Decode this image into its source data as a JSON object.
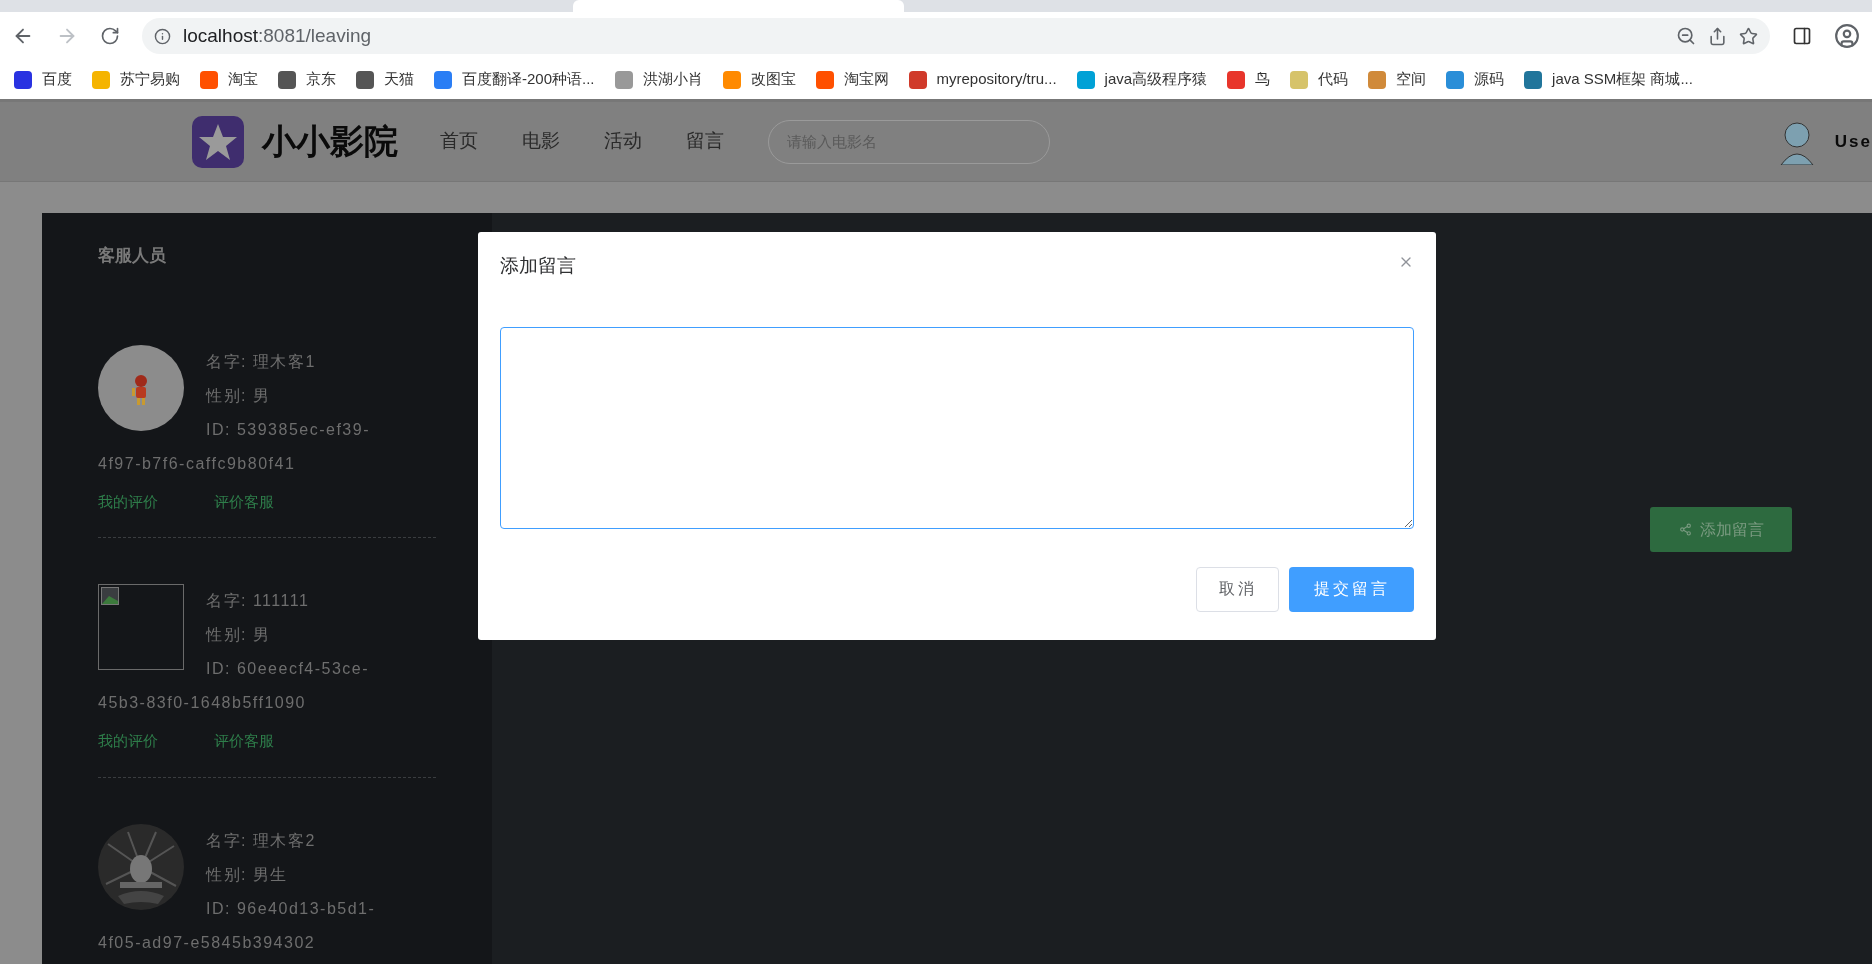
{
  "address": {
    "host": "localhost",
    "rest": ":8081/leaving"
  },
  "bookmarks": [
    {
      "label": "百度",
      "color": "#2932e1"
    },
    {
      "label": "苏宁易购",
      "color": "#f5b400"
    },
    {
      "label": "淘宝",
      "color": "#ff5000"
    },
    {
      "label": "京东",
      "color": "#555555"
    },
    {
      "label": "天猫",
      "color": "#555555"
    },
    {
      "label": "百度翻译-200种语...",
      "color": "#2a7ef5"
    },
    {
      "label": "洪湖小肖",
      "color": "#999999"
    },
    {
      "label": "改图宝",
      "color": "#ff8a00"
    },
    {
      "label": "淘宝网",
      "color": "#ff5000"
    },
    {
      "label": "myrepository/tru...",
      "color": "#d03a2a"
    },
    {
      "label": "java高级程序猿",
      "color": "#00a1d6"
    },
    {
      "label": "鸟",
      "color": "#e8352b"
    },
    {
      "label": "代码",
      "color": "#d6c36a"
    },
    {
      "label": "空间",
      "color": "#d08a3a"
    },
    {
      "label": "源码",
      "color": "#2a8ed8"
    },
    {
      "label": "java SSM框架 商城...",
      "color": "#21759b"
    }
  ],
  "header": {
    "logo": "小小影院",
    "nav": [
      "首页",
      "电影",
      "活动",
      "留言"
    ],
    "search": {
      "placeholder": "请输入电影名"
    },
    "user": "Use"
  },
  "sidebar": {
    "title": "客服人员",
    "staff": [
      {
        "kind": "round-photo",
        "name": "名字: 理木客1",
        "gender": "性别: 男",
        "id_lines": [
          "ID: 539385ec-ef39-",
          "4f97-b7f6-caffc9b80f41"
        ],
        "links": [
          "我的评价",
          "评价客服"
        ]
      },
      {
        "kind": "broken-image",
        "name": "名字: 111111",
        "gender": "性别: 男",
        "id_lines": [
          "ID: 60eeecf4-53ce-",
          "45b3-83f0-1648b5ff1090"
        ],
        "links": [
          "我的评价",
          "评价客服"
        ]
      },
      {
        "kind": "round-dark-photo",
        "name": "名字: 理木客2",
        "gender": "性别: 男生",
        "id_lines": [
          "ID: 96e40d13-b5d1-",
          "4f05-ad97-e5845b394302"
        ]
      }
    ]
  },
  "add_button": "添加留言",
  "dialog": {
    "title": "添加留言",
    "buttons": [
      {
        "label": "取消",
        "kind": "secondary"
      },
      {
        "label": "提交留言",
        "kind": "primary"
      }
    ]
  }
}
